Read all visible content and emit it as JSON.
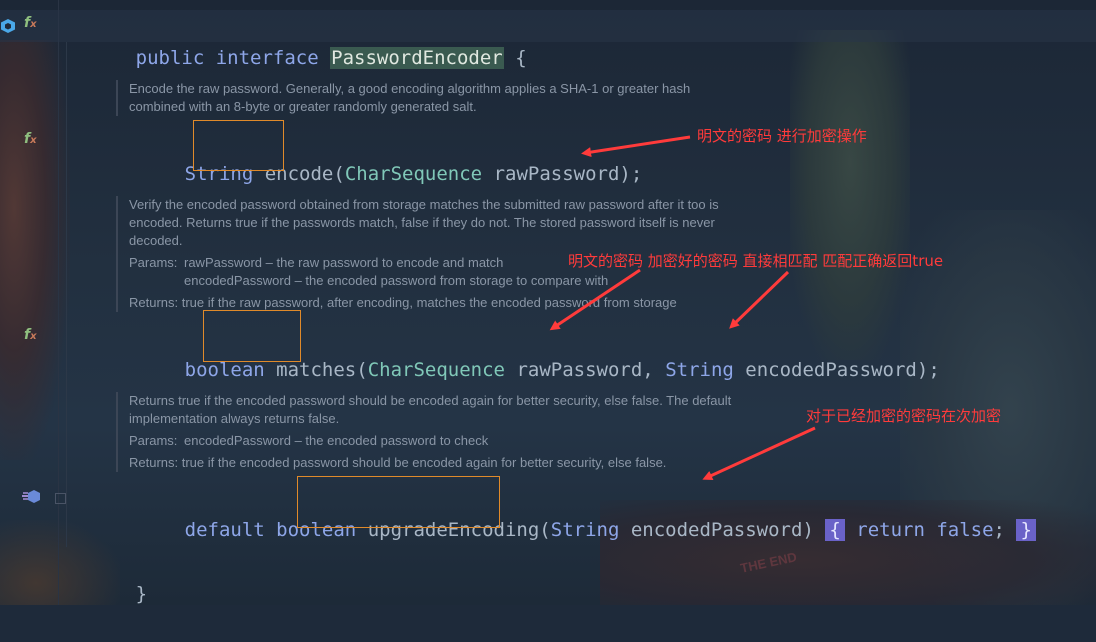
{
  "code": {
    "line1": {
      "kw_public": "public",
      "kw_interface": "interface",
      "name": "PasswordEncoder",
      "brace": "{"
    },
    "encode": {
      "ret": "String",
      "name": "encode",
      "open": "(",
      "ptype": "CharSequence",
      "pname": "rawPassword",
      "close": ");"
    },
    "matches": {
      "ret": "boolean",
      "name": "matches",
      "open": "(",
      "p1type": "CharSequence",
      "p1name": "rawPassword",
      "comma": ",",
      "p2type": "String",
      "p2name": "encodedPassword",
      "close": ");"
    },
    "upgrade": {
      "kw_default": "default",
      "ret": "boolean",
      "name": "upgradeEncoding",
      "open": "(",
      "ptype": "String",
      "pname": "encodedPassword",
      "close": ")",
      "lbrace": "{",
      "kw_return": "return",
      "kw_false": "false",
      "semi": ";",
      "rbrace": "}"
    },
    "closing_brace": "}"
  },
  "docs": {
    "encode": "Encode the raw password. Generally, a good encoding algorithm applies a SHA-1 or greater hash combined with an 8-byte or greater randomly generated salt.",
    "matches_desc": "Verify the encoded password obtained from storage matches the submitted raw password after it too is encoded. Returns true if the passwords match, false if they do not. The stored password itself is never decoded.",
    "matches_params_label": "Params:",
    "matches_param1": "rawPassword – the raw password to encode and match",
    "matches_param2": "encodedPassword – the encoded password from storage to compare with",
    "matches_returns": "Returns: true if the raw password, after encoding, matches the encoded password from storage",
    "upgrade_desc": "Returns true if the encoded password should be encoded again for better security, else false. The default implementation always returns false.",
    "upgrade_params_label": "Params:",
    "upgrade_param1": "encodedPassword – the encoded password to check",
    "upgrade_returns": "Returns: true if the encoded password should be encoded again for better security, else false."
  },
  "annotations": {
    "encode": "明文的密码 进行加密操作",
    "matches": "明文的密码 加密好的密码 直接相匹配 匹配正确返回true",
    "upgrade": "对于已经加密的密码在次加密"
  },
  "gutter_icons": {
    "interface_marker": "interface-implemented-icon",
    "method_marker": "function-implemented-icon",
    "default_method_marker": "method-override-icon"
  },
  "colors": {
    "keyword": "#8ea6e8",
    "type": "#80c8b8",
    "annotation_red": "#ff3b3b",
    "highlight_box": "#e08a2a",
    "brace_match": "#6a62c8"
  },
  "background_text": "THE END"
}
